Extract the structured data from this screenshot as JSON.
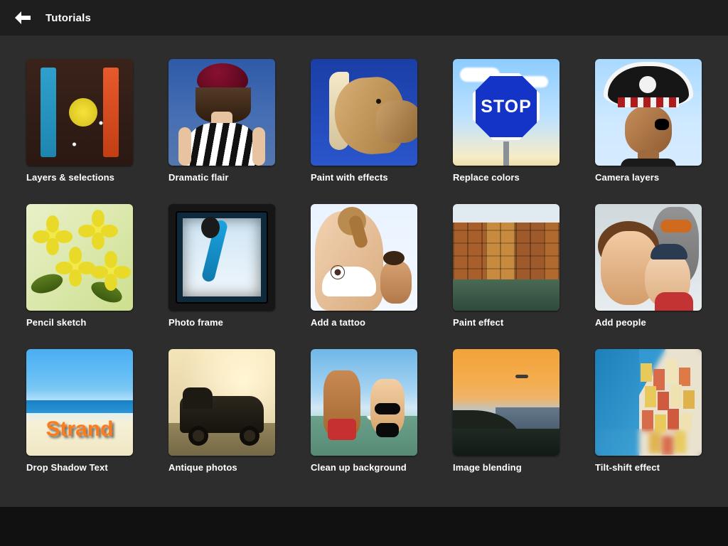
{
  "header": {
    "title": "Tutorials",
    "back_icon": "back-arrow-icon"
  },
  "tiles": [
    {
      "label": "Layers & selections",
      "thumb": "layers-selections"
    },
    {
      "label": "Dramatic flair",
      "thumb": "dramatic-flair"
    },
    {
      "label": "Paint with effects",
      "thumb": "paint-with-effects"
    },
    {
      "label": "Replace colors",
      "thumb": "replace-colors",
      "sign_text": "STOP"
    },
    {
      "label": "Camera layers",
      "thumb": "camera-layers"
    },
    {
      "label": "Pencil sketch",
      "thumb": "pencil-sketch"
    },
    {
      "label": "Photo frame",
      "thumb": "photo-frame"
    },
    {
      "label": "Add a tattoo",
      "thumb": "add-a-tattoo"
    },
    {
      "label": "Paint effect",
      "thumb": "paint-effect"
    },
    {
      "label": "Add people",
      "thumb": "add-people"
    },
    {
      "label": "Drop Shadow Text",
      "thumb": "drop-shadow-text",
      "overlay_text": "Strand"
    },
    {
      "label": "Antique photos",
      "thumb": "antique-photos"
    },
    {
      "label": "Clean up background",
      "thumb": "clean-up-background"
    },
    {
      "label": "Image blending",
      "thumb": "image-blending"
    },
    {
      "label": "Tilt-shift effect",
      "thumb": "tilt-shift-effect"
    }
  ]
}
